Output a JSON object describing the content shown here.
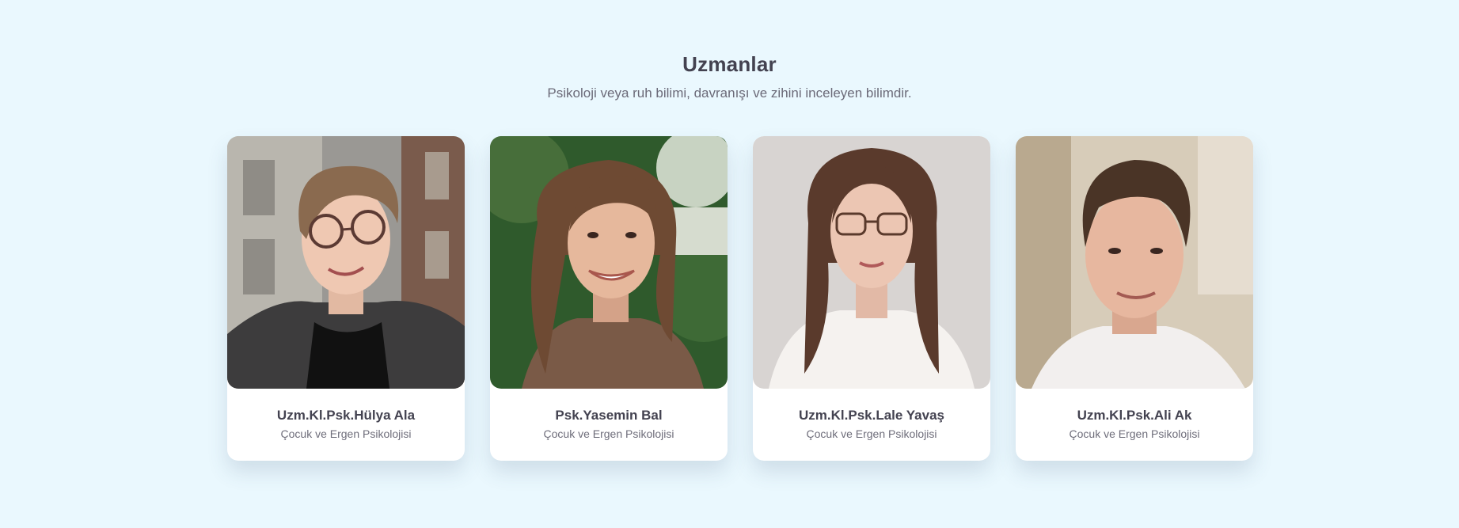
{
  "section": {
    "title": "Uzmanlar",
    "subtitle": "Psikoloji veya ruh bilimi, davranışı ve zihini inceleyen bilimdir."
  },
  "experts": [
    {
      "name": "Uzm.Kl.Psk.Hülya Ala",
      "specialty": "Çocuk ve Ergen Psikolojisi"
    },
    {
      "name": "Psk.Yasemin Bal",
      "specialty": "Çocuk ve Ergen Psikolojisi"
    },
    {
      "name": "Uzm.Kl.Psk.Lale Yavaş",
      "specialty": "Çocuk ve Ergen Psikolojisi"
    },
    {
      "name": "Uzm.Kl.Psk.Ali Ak",
      "specialty": "Çocuk ve Ergen Psikolojisi"
    }
  ],
  "colors": {
    "background": "#eaf8fe",
    "card": "#ffffff",
    "heading": "#434250",
    "text": "#6b6a78"
  }
}
